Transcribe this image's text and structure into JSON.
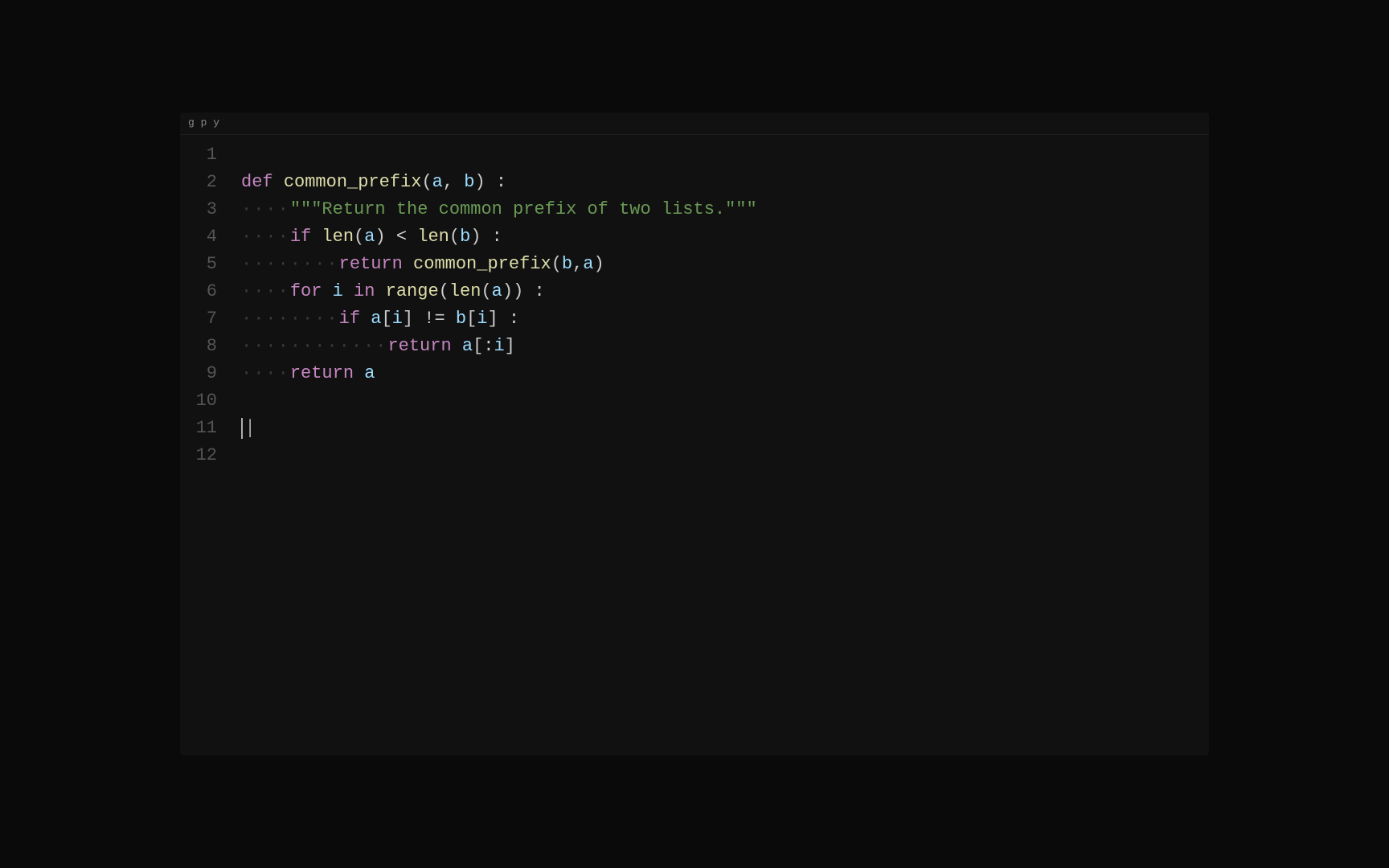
{
  "editor": {
    "background": "#111111",
    "top_bar_text": "g                           p y",
    "lines": [
      {
        "num": 1,
        "content": []
      },
      {
        "num": 2,
        "content": [
          {
            "type": "kw-def",
            "text": "def "
          },
          {
            "type": "fn-name",
            "text": "common_prefix"
          },
          {
            "type": "punct",
            "text": "("
          },
          {
            "type": "param",
            "text": "a"
          },
          {
            "type": "punct",
            "text": ", "
          },
          {
            "type": "param",
            "text": "b"
          },
          {
            "type": "punct",
            "text": ") :"
          }
        ]
      },
      {
        "num": 3,
        "indent": "····",
        "content": [
          {
            "type": "docstring",
            "text": "\"\"\"Return the common prefix of two lists.\"\"\""
          }
        ]
      },
      {
        "num": 4,
        "indent": "····",
        "content": [
          {
            "type": "kw-if",
            "text": "if "
          },
          {
            "type": "builtin",
            "text": "len"
          },
          {
            "type": "punct",
            "text": "("
          },
          {
            "type": "var",
            "text": "a"
          },
          {
            "type": "punct",
            "text": ") < "
          },
          {
            "type": "builtin",
            "text": "len"
          },
          {
            "type": "punct",
            "text": "("
          },
          {
            "type": "var",
            "text": "b"
          },
          {
            "type": "punct",
            "text": ") :"
          }
        ]
      },
      {
        "num": 5,
        "indent": "········",
        "content": [
          {
            "type": "kw-return",
            "text": "return "
          },
          {
            "type": "fn-name",
            "text": "common_prefix"
          },
          {
            "type": "punct",
            "text": "("
          },
          {
            "type": "var",
            "text": "b"
          },
          {
            "type": "punct",
            "text": ","
          },
          {
            "type": "var",
            "text": "a"
          },
          {
            "type": "punct",
            "text": ")"
          }
        ]
      },
      {
        "num": 6,
        "indent": "····",
        "content": [
          {
            "type": "kw-for",
            "text": "for "
          },
          {
            "type": "var",
            "text": "i"
          },
          {
            "type": "kw-in",
            "text": " in "
          },
          {
            "type": "builtin",
            "text": "range"
          },
          {
            "type": "punct",
            "text": "("
          },
          {
            "type": "builtin",
            "text": "len"
          },
          {
            "type": "punct",
            "text": "("
          },
          {
            "type": "var",
            "text": "a"
          },
          {
            "type": "punct",
            "text": ")) :"
          }
        ]
      },
      {
        "num": 7,
        "indent": "········",
        "content": [
          {
            "type": "kw-if",
            "text": "if "
          },
          {
            "type": "var",
            "text": "a"
          },
          {
            "type": "punct",
            "text": "["
          },
          {
            "type": "var",
            "text": "i"
          },
          {
            "type": "punct",
            "text": "] "
          },
          {
            "type": "op",
            "text": "!="
          },
          {
            "type": "punct",
            "text": " "
          },
          {
            "type": "var",
            "text": "b"
          },
          {
            "type": "punct",
            "text": "["
          },
          {
            "type": "var",
            "text": "i"
          },
          {
            "type": "punct",
            "text": "] :"
          }
        ]
      },
      {
        "num": 8,
        "indent": "············",
        "content": [
          {
            "type": "kw-return",
            "text": "return "
          },
          {
            "type": "var",
            "text": "a"
          },
          {
            "type": "punct",
            "text": "[:"
          },
          {
            "type": "var",
            "text": "i"
          },
          {
            "type": "punct",
            "text": "]"
          }
        ]
      },
      {
        "num": 9,
        "indent": "····",
        "content": [
          {
            "type": "kw-return",
            "text": "return "
          },
          {
            "type": "var",
            "text": "a"
          }
        ]
      },
      {
        "num": 10,
        "content": []
      },
      {
        "num": 11,
        "content": [],
        "cursor": true
      },
      {
        "num": 12,
        "content": []
      }
    ]
  },
  "colors": {
    "background": "#0a0a0a",
    "editor_bg": "#111111",
    "line_number": "#555555",
    "keyword": "#c586c0",
    "function": "#dcdcaa",
    "variable": "#9cdcfe",
    "string": "#ce9178",
    "docstring": "#6a9955",
    "punctuation": "#cccccc",
    "indent_dot": "#3a3a3a"
  }
}
